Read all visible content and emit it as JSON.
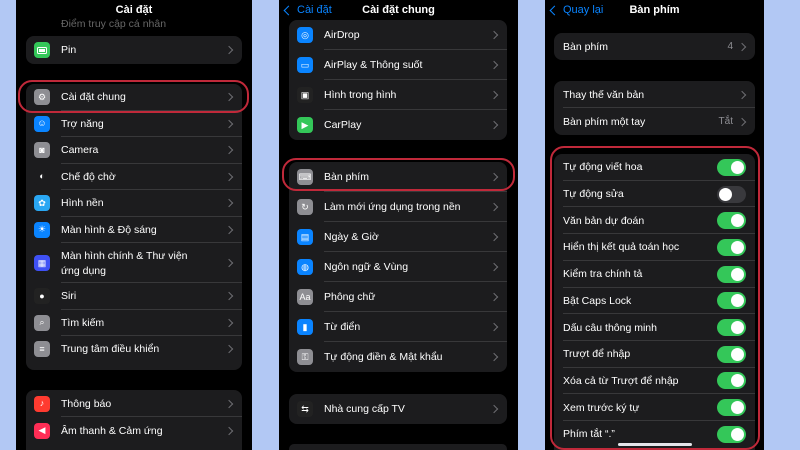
{
  "panel1": {
    "title": "Cài đặt",
    "top_partial": "Điểm truy cập cá nhân",
    "group1": [
      {
        "label": "Pin",
        "icon": "battery-icon",
        "color": "#34c759"
      }
    ],
    "group2": [
      {
        "label": "Cài đặt chung",
        "icon": "gear-icon",
        "color": "#8e8e93"
      },
      {
        "label": "Trợ năng",
        "icon": "accessibility-icon",
        "color": "#0a84ff"
      },
      {
        "label": "Camera",
        "icon": "camera-icon",
        "color": "#8e8e93"
      },
      {
        "label": "Chế độ chờ",
        "icon": "standby-icon",
        "color": "#1c1c1e"
      },
      {
        "label": "Hình nền",
        "icon": "wallpaper-icon",
        "color": "#2aa7f3"
      },
      {
        "label": "Màn hình & Độ sáng",
        "icon": "brightness-icon",
        "color": "#0a84ff"
      },
      {
        "label": "Màn hình chính & Thư viện",
        "label2": "ứng dụng",
        "icon": "home-screen-icon",
        "color": "#3f51f5"
      },
      {
        "label": "Siri",
        "icon": "siri-icon",
        "color": "#222"
      },
      {
        "label": "Tìm kiếm",
        "icon": "search-icon",
        "color": "#8e8e93"
      },
      {
        "label": "Trung tâm điều khiển",
        "icon": "control-center-icon",
        "color": "#8e8e93"
      }
    ],
    "group3": [
      {
        "label": "Thông báo",
        "icon": "bell-icon",
        "color": "#ff3b30"
      },
      {
        "label": "Âm thanh & Cảm ứng",
        "icon": "speaker-icon",
        "color": "#ff2d55"
      }
    ]
  },
  "panel2": {
    "back": "Cài đặt",
    "title": "Cài đặt chung",
    "group1": [
      {
        "label": "AirDrop",
        "icon": "airdrop-icon",
        "color": "#0a84ff"
      },
      {
        "label": "AirPlay & Thông suốt",
        "icon": "airplay-icon",
        "color": "#0a84ff"
      },
      {
        "label": "Hình trong hình",
        "icon": "pip-icon",
        "color": "#222"
      },
      {
        "label": "CarPlay",
        "icon": "carplay-icon",
        "color": "#34c759"
      }
    ],
    "group2": [
      {
        "label": "Bàn phím",
        "icon": "keyboard-icon",
        "color": "#8e8e93"
      },
      {
        "label": "Làm mới ứng dụng trong nền",
        "icon": "refresh-icon",
        "color": "#8e8e93"
      },
      {
        "label": "Ngày & Giờ",
        "icon": "calendar-icon",
        "color": "#0a84ff"
      },
      {
        "label": "Ngôn ngữ & Vùng",
        "icon": "globe-icon",
        "color": "#0a84ff"
      },
      {
        "label": "Phông chữ",
        "icon": "font-icon",
        "icon_text": "Aa",
        "color": "#8e8e93"
      },
      {
        "label": "Từ điển",
        "icon": "dictionary-icon",
        "color": "#0a84ff"
      },
      {
        "label": "Tự động điền & Mật khẩu",
        "icon": "key-icon",
        "color": "#8e8e93"
      }
    ],
    "group3": [
      {
        "label": "Nhà cung cấp TV",
        "icon": "tv-provider-icon",
        "color": "#222"
      }
    ]
  },
  "panel3": {
    "back": "Quay lại",
    "title": "Bàn phím",
    "keyboards": {
      "label": "Bàn phím",
      "value": "4"
    },
    "group2": [
      {
        "label": "Thay thế văn bản",
        "value": ""
      },
      {
        "label": "Bàn phím một tay",
        "value": "Tắt"
      }
    ],
    "toggles": [
      {
        "label": "Tự động viết hoa",
        "on": true
      },
      {
        "label": "Tự động sửa",
        "on": false
      },
      {
        "label": "Văn bản dự đoán",
        "on": true
      },
      {
        "label": "Hiển thị kết quả toán học",
        "on": true
      },
      {
        "label": "Kiểm tra chính tả",
        "on": true
      },
      {
        "label": "Bật Caps Lock",
        "on": true
      },
      {
        "label": "Dấu câu thông minh",
        "on": true
      },
      {
        "label": "Trượt để nhập",
        "on": true
      },
      {
        "label": "Xóa cả từ Trượt để nhập",
        "on": true
      },
      {
        "label": "Xem trước ký tự",
        "on": true
      },
      {
        "label": "Phím tắt “.”",
        "on": true
      }
    ]
  },
  "colors": {
    "highlight": "#c0293a",
    "toggle_on": "#34c759",
    "background": "#b2c8f4"
  }
}
